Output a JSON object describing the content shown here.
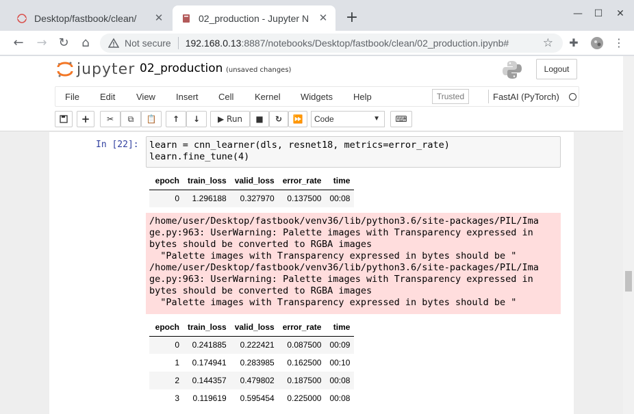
{
  "browser": {
    "tabs": [
      {
        "title": "Desktop/fastbook/clean/",
        "active": false,
        "icon": "jupyter-icon"
      },
      {
        "title": "02_production - Jupyter N",
        "active": true,
        "icon": "notebook-icon"
      }
    ],
    "new_tab": "+",
    "omnibox": {
      "security": "Not secure",
      "host": "192.168.0.13",
      "path": ":8887/notebooks/Desktop/fastbook/clean/02_production.ipynb#"
    }
  },
  "jupyter": {
    "logo_text": "jupyter",
    "notebook_name": "02_production",
    "save_status": "(unsaved changes)",
    "logout": "Logout",
    "menu": [
      "File",
      "Edit",
      "View",
      "Insert",
      "Cell",
      "Kernel",
      "Widgets",
      "Help"
    ],
    "trusted": "Trusted",
    "kernel": "FastAI (PyTorch)",
    "toolbar": {
      "run_label": "Run",
      "cell_type": "Code"
    }
  },
  "cell": {
    "prompt": "In [22]:",
    "code": "learn = cnn_learner(dls, resnet18, metrics=error_rate)\nlearn.fine_tune(4)"
  },
  "table1": {
    "headers": [
      "epoch",
      "train_loss",
      "valid_loss",
      "error_rate",
      "time"
    ],
    "rows": [
      [
        "0",
        "1.296188",
        "0.327970",
        "0.137500",
        "00:08"
      ]
    ]
  },
  "stderr": "/home/user/Desktop/fastbook/venv36/lib/python3.6/site-packages/PIL/Ima\nge.py:963: UserWarning: Palette images with Transparency expressed in\nbytes should be converted to RGBA images\n  \"Palette images with Transparency expressed in bytes should be \"\n/home/user/Desktop/fastbook/venv36/lib/python3.6/site-packages/PIL/Ima\nge.py:963: UserWarning: Palette images with Transparency expressed in\nbytes should be converted to RGBA images\n  \"Palette images with Transparency expressed in bytes should be \"",
  "table2": {
    "headers": [
      "epoch",
      "train_loss",
      "valid_loss",
      "error_rate",
      "time"
    ],
    "rows": [
      [
        "0",
        "0.241885",
        "0.222421",
        "0.087500",
        "00:09"
      ],
      [
        "1",
        "0.174941",
        "0.283985",
        "0.162500",
        "00:10"
      ],
      [
        "2",
        "0.144357",
        "0.479802",
        "0.187500",
        "00:08"
      ],
      [
        "3",
        "0.119619",
        "0.595454",
        "0.225000",
        "00:08"
      ]
    ]
  }
}
